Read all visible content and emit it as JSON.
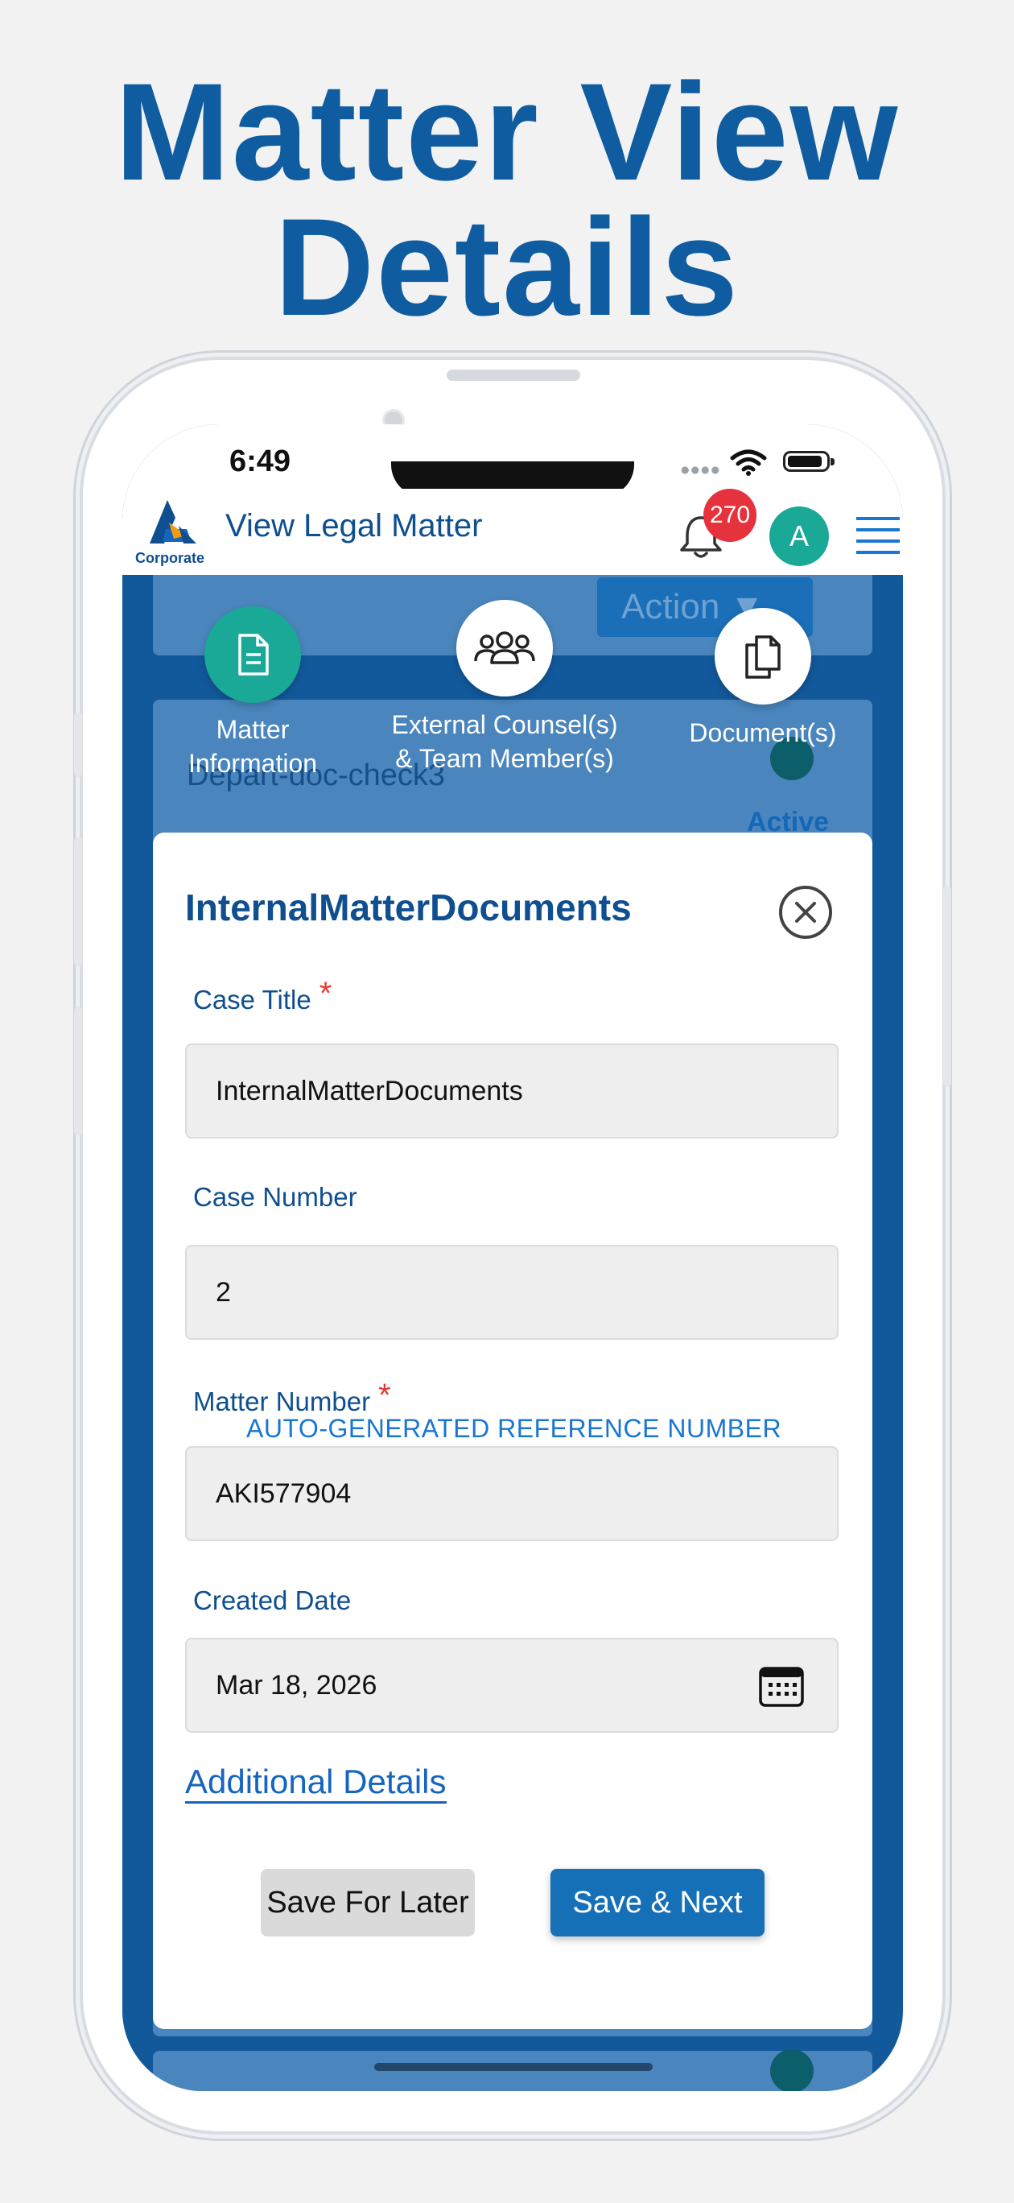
{
  "headline": {
    "line1": "Matter View",
    "line2": "Details"
  },
  "status_bar": {
    "time": "6:49"
  },
  "app_header": {
    "logo_text": "Corporate",
    "title": "View Legal Matter",
    "notification_count": "270",
    "avatar_initial": "A"
  },
  "background": {
    "action_label": "Action ▼",
    "record_title": "Depart-doc-check3",
    "record_status": "Active"
  },
  "tabs": [
    {
      "label_line1": "Matter",
      "label_line2": "Information",
      "icon": "document-icon",
      "active": true
    },
    {
      "label_line1": "External Counsel(s)",
      "label_line2": "& Team Member(s)",
      "icon": "team-icon",
      "active": false
    },
    {
      "label_line1": "Document(s)",
      "label_line2": "",
      "icon": "copy-documents-icon",
      "active": false
    }
  ],
  "modal": {
    "title": "InternalMatterDocuments",
    "fields": {
      "case_title": {
        "label": "Case Title",
        "required_mark": "*",
        "value": "InternalMatterDocuments"
      },
      "case_number": {
        "label": "Case Number",
        "value": "2"
      },
      "matter_number": {
        "label": "Matter Number",
        "required_mark": "*",
        "hint": "AUTO-GENERATED REFERENCE NUMBER",
        "value": "AKI577904"
      },
      "created_date": {
        "label": "Created Date",
        "value": "Mar 18, 2026"
      }
    },
    "additional_details_link": "Additional Details",
    "save_later_label": "Save For Later",
    "save_next_label": "Save & Next"
  },
  "colors": {
    "headline": "#0f5ca0",
    "screen_background": "#12599c",
    "accent_teal": "#1aa897",
    "primary_button": "#1670b8",
    "badge_red": "#e6323c",
    "required_red": "#e53935"
  }
}
